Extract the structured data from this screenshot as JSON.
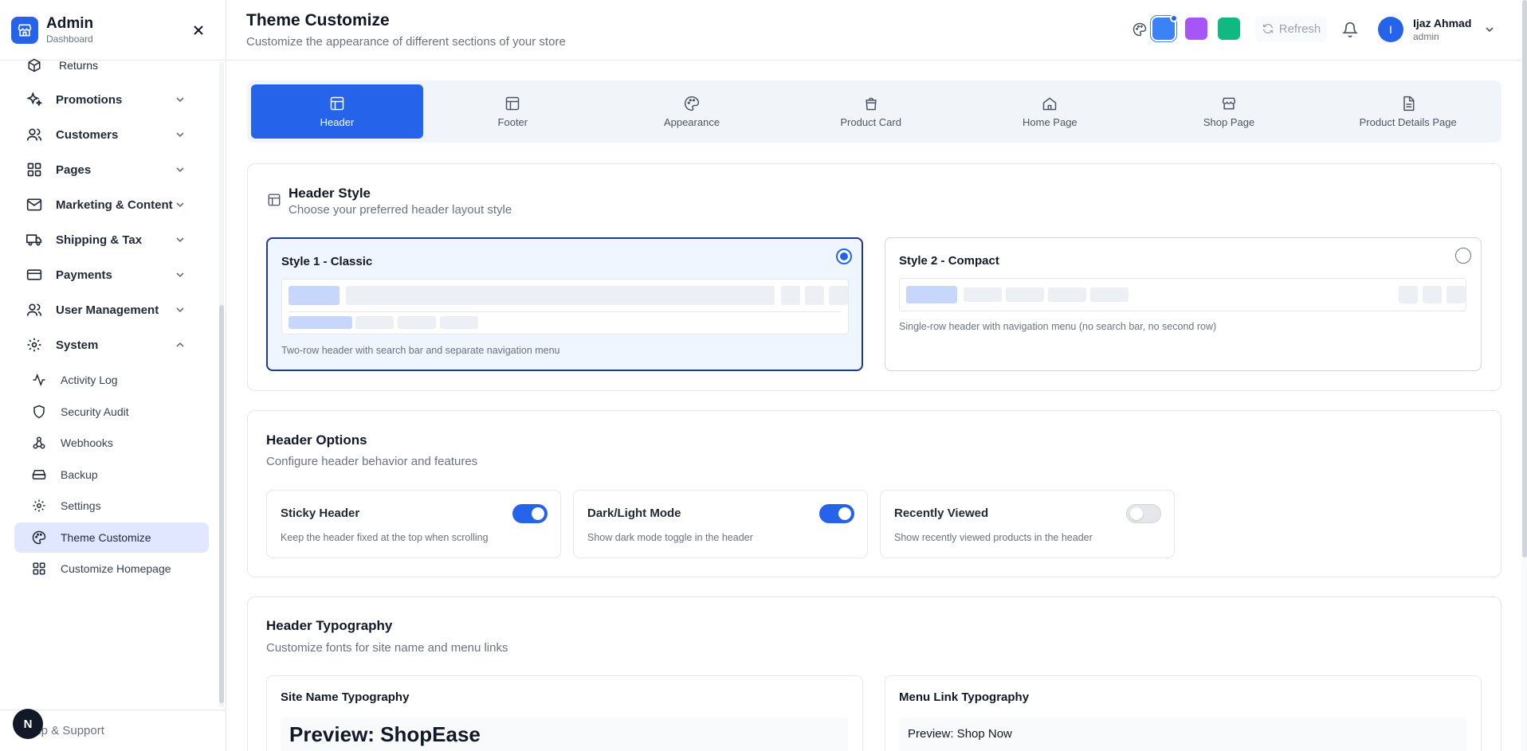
{
  "brand": {
    "title": "Admin",
    "subtitle": "Dashboard"
  },
  "sidebar": {
    "items": [
      {
        "label": "Returns",
        "icon": "box-icon"
      },
      {
        "label": "Promotions",
        "icon": "sparkles-icon"
      },
      {
        "label": "Customers",
        "icon": "users-icon"
      },
      {
        "label": "Pages",
        "icon": "grid-icon"
      },
      {
        "label": "Marketing & Content",
        "icon": "mail-icon"
      },
      {
        "label": "Shipping & Tax",
        "icon": "truck-icon"
      },
      {
        "label": "Payments",
        "icon": "credit-card-icon"
      },
      {
        "label": "User Management",
        "icon": "users-icon"
      },
      {
        "label": "System",
        "icon": "gear-icon"
      }
    ],
    "system_children": [
      {
        "label": "Activity Log",
        "icon": "activity-icon"
      },
      {
        "label": "Security Audit",
        "icon": "shield-icon"
      },
      {
        "label": "Webhooks",
        "icon": "webhook-icon"
      },
      {
        "label": "Backup",
        "icon": "hard-drive-icon"
      },
      {
        "label": "Settings",
        "icon": "gear-icon"
      },
      {
        "label": "Theme Customize",
        "icon": "palette-icon",
        "active": true
      },
      {
        "label": "Customize Homepage",
        "icon": "grid-icon"
      }
    ],
    "help_label": "elp & Support",
    "badge_letter": "N"
  },
  "header": {
    "title": "Theme Customize",
    "subtitle": "Customize the appearance of different sections of your store",
    "swatches": [
      "#3b82f6",
      "#a855f7",
      "#10b981"
    ],
    "refresh_label": "Refresh",
    "user": {
      "initial": "I",
      "name": "Ijaz Ahmad",
      "role": "admin"
    }
  },
  "tabs": [
    {
      "label": "Header",
      "icon": "layout-icon",
      "active": true
    },
    {
      "label": "Footer",
      "icon": "layout-icon"
    },
    {
      "label": "Appearance",
      "icon": "palette-icon"
    },
    {
      "label": "Product Card",
      "icon": "shopping-bag-icon"
    },
    {
      "label": "Home Page",
      "icon": "home-icon"
    },
    {
      "label": "Shop Page",
      "icon": "store-icon"
    },
    {
      "label": "Product Details Page",
      "icon": "file-text-icon"
    }
  ],
  "header_style": {
    "title": "Header Style",
    "subtitle": "Choose your preferred header layout style",
    "options": [
      {
        "name": "Style 1 - Classic",
        "desc": "Two-row header with search bar and separate navigation menu",
        "selected": true
      },
      {
        "name": "Style 2 - Compact",
        "desc": "Single-row header with navigation menu (no search bar, no second row)",
        "selected": false
      }
    ]
  },
  "header_options": {
    "title": "Header Options",
    "subtitle": "Configure header behavior and features",
    "items": [
      {
        "name": "Sticky Header",
        "desc": "Keep the header fixed at the top when scrolling",
        "on": true
      },
      {
        "name": "Dark/Light Mode",
        "desc": "Show dark mode toggle in the header",
        "on": true
      },
      {
        "name": "Recently Viewed",
        "desc": "Show recently viewed products in the header",
        "on": false
      }
    ]
  },
  "header_typography": {
    "title": "Header Typography",
    "subtitle": "Customize fonts for site name and menu links",
    "site_name": {
      "title": "Site Name Typography",
      "preview": "Preview: ShopEase"
    },
    "menu_link": {
      "title": "Menu Link Typography",
      "preview": "Preview: Shop Now"
    }
  }
}
